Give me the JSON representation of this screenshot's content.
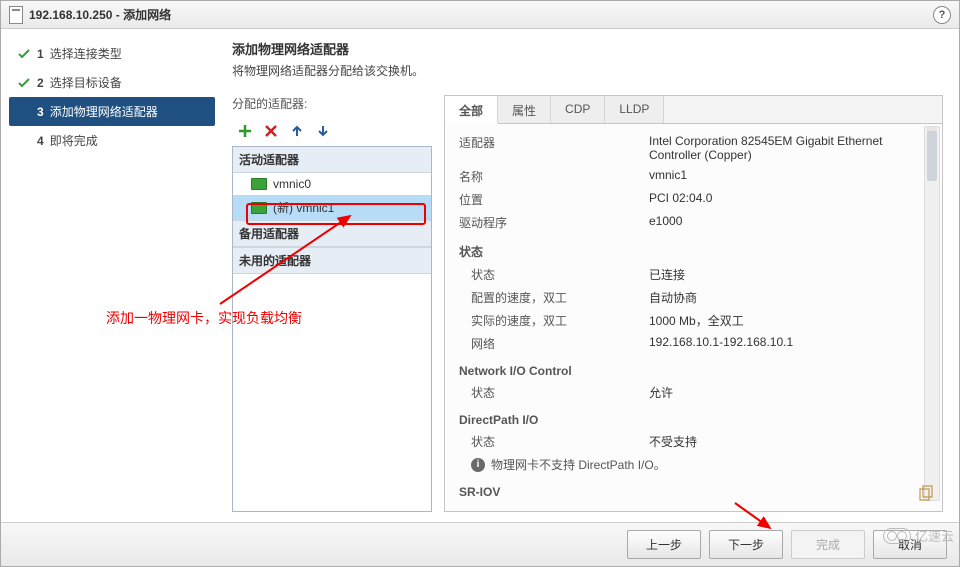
{
  "window": {
    "title": "192.168.10.250 - 添加网络"
  },
  "steps": {
    "s1": {
      "num": "1",
      "label": "选择连接类型"
    },
    "s2": {
      "num": "2",
      "label": "选择目标设备"
    },
    "s3": {
      "num": "3",
      "label": "添加物理网络适配器"
    },
    "s4": {
      "num": "4",
      "label": "即将完成"
    }
  },
  "heading": "添加物理网络适配器",
  "subheading": "将物理网络适配器分配给该交换机。",
  "alloc_label": "分配的适配器:",
  "groups": {
    "active": "活动适配器",
    "standby": "备用适配器",
    "unused": "未用的适配器"
  },
  "adapters": {
    "a0": "vmnic0",
    "a1": "(新) vmnic1"
  },
  "tabs": {
    "all": "全部",
    "props": "属性",
    "cdp": "CDP",
    "lldp": "LLDP"
  },
  "details": {
    "adapter_k": "适配器",
    "adapter_v": "Intel Corporation 82545EM Gigabit Ethernet Controller (Copper)",
    "name_k": "名称",
    "name_v": "vmnic1",
    "loc_k": "位置",
    "loc_v": "PCI 02:04.0",
    "drv_k": "驱动程序",
    "drv_v": "e1000",
    "sec_status": "状态",
    "status_k": "状态",
    "status_v": "已连接",
    "cfg_k": "配置的速度，双工",
    "cfg_v": "自动协商",
    "act_k": "实际的速度，双工",
    "act_v": "1000 Mb，全双工",
    "net_k": "网络",
    "net_v": "192.168.10.1-192.168.10.1",
    "sec_nioc": "Network I/O Control",
    "nioc_k": "状态",
    "nioc_v": "允许",
    "sec_dp": "DirectPath I/O",
    "dp_k": "状态",
    "dp_v": "不受支持",
    "dp_info": "物理网卡不支持 DirectPath I/O。",
    "sec_sriov": "SR-IOV"
  },
  "buttons": {
    "prev": "上一步",
    "next": "下一步",
    "finish": "完成",
    "cancel": "取消"
  },
  "annotation": "添加一物理网卡，实现负载均衡",
  "watermark": "亿速云"
}
